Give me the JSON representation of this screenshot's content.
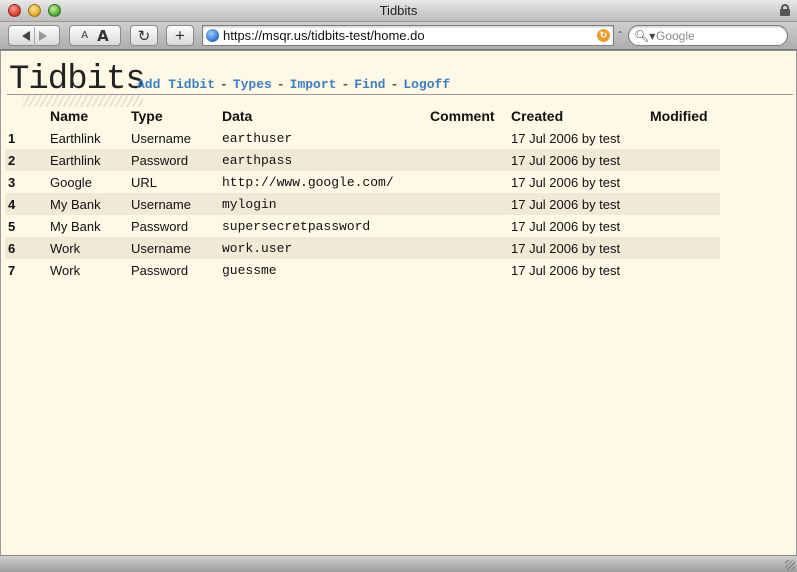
{
  "window": {
    "title": "Tidbits"
  },
  "toolbar": {
    "url": "https://msqr.us/tidbits-test/home.do",
    "search_placeholder": "Google",
    "text_small_label": "A",
    "text_big_label": "A",
    "reload_symbol": "↻",
    "add_symbol": "+"
  },
  "app": {
    "logo": "Tidbits",
    "nav": [
      "Add Tidbit",
      "Types",
      "Import",
      "Find",
      "Logoff"
    ]
  },
  "table": {
    "headers": [
      "",
      "Name",
      "Type",
      "Data",
      "Comment",
      "Created",
      "Modified"
    ],
    "rows": [
      [
        "1",
        "Earthlink",
        "Username",
        "earthuser",
        "",
        "17 Jul 2006 by test",
        ""
      ],
      [
        "2",
        "Earthlink",
        "Password",
        "earthpass",
        "",
        "17 Jul 2006 by test",
        ""
      ],
      [
        "3",
        "Google",
        "URL",
        "http://www.google.com/",
        "",
        "17 Jul 2006 by test",
        ""
      ],
      [
        "4",
        "My Bank",
        "Username",
        "mylogin",
        "",
        "17 Jul 2006 by test",
        ""
      ],
      [
        "5",
        "My Bank",
        "Password",
        "supersecretpassword",
        "",
        "17 Jul 2006 by test",
        ""
      ],
      [
        "6",
        "Work",
        "Username",
        "work.user",
        "",
        "17 Jul 2006 by test",
        ""
      ],
      [
        "7",
        "Work",
        "Password",
        "guessme",
        "",
        "17 Jul 2006 by test",
        ""
      ]
    ]
  },
  "colors": {
    "page_bg": "#fff8e6",
    "row_alt": "#f2e8d6",
    "link": "#3c80c4"
  }
}
